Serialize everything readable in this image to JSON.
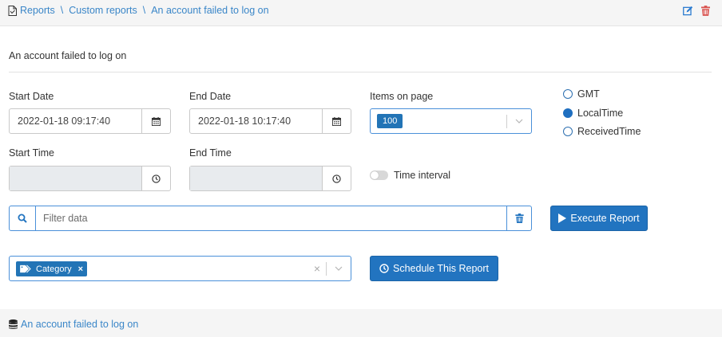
{
  "breadcrumb": {
    "items": [
      "Reports",
      "Custom reports",
      "An account failed to log on"
    ],
    "separator": "\\"
  },
  "section_title": "An account failed to log on",
  "start_date": {
    "label": "Start Date",
    "value": "2022-01-18 09:17:40"
  },
  "end_date": {
    "label": "End Date",
    "value": "2022-01-18 10:17:40"
  },
  "start_time": {
    "label": "Start Time",
    "value": ""
  },
  "end_time": {
    "label": "End Time",
    "value": ""
  },
  "items_on_page": {
    "label": "Items on page",
    "selected": "100"
  },
  "timezone": {
    "options": [
      "GMT",
      "LocalTime",
      "ReceivedTime"
    ],
    "selected": "LocalTime"
  },
  "time_interval": {
    "label": "Time interval",
    "enabled": false
  },
  "filter": {
    "placeholder": "Filter data",
    "value": ""
  },
  "buttons": {
    "execute": "Execute Report",
    "schedule": "Schedule This Report"
  },
  "category_tag": {
    "label": "Category"
  },
  "footer": {
    "link": "An account failed to log on"
  },
  "colors": {
    "accent": "#2274c0",
    "link": "#3a86c8",
    "delete": "#d9534f",
    "edit": "#2a7bd0"
  },
  "icons": {
    "breadcrumb": "document-icon",
    "edit": "edit-icon",
    "delete": "trash-icon",
    "calendar": "calendar-icon",
    "clock": "clock-icon",
    "search": "search-icon",
    "play": "play-icon",
    "schedule": "clock-icon",
    "tag": "tag-icon",
    "database": "database-icon"
  }
}
